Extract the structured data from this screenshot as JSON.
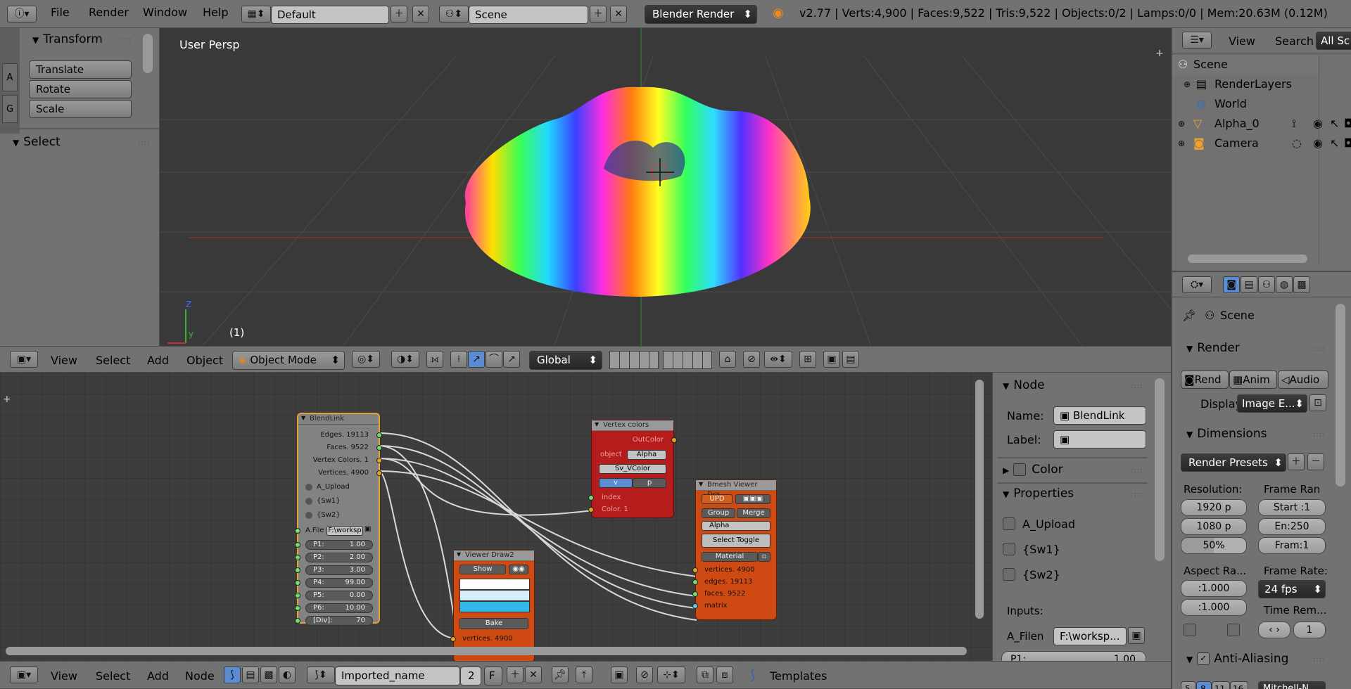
{
  "top_header": {
    "menus": [
      "File",
      "Render",
      "Window",
      "Help"
    ],
    "layout": "Default",
    "scene": "Scene",
    "engine": "Blender Render",
    "stats": "v2.77 | Verts:4,900 | Faces:9,522 | Tris:9,522 | Objects:0/2 | Lamps:0/0 | Mem:20.63M (0.12M)"
  },
  "tool_shelf": {
    "tabs": [
      "A",
      "G"
    ],
    "transform_title": "Transform",
    "buttons": [
      "Translate",
      "Rotate",
      "Scale"
    ],
    "select_title": "Select"
  },
  "viewport": {
    "label": "User Persp",
    "frame": "(1)",
    "axis_z": "Z",
    "axis_y": "y"
  },
  "view3d_header": {
    "menus": [
      "View",
      "Select",
      "Add",
      "Object"
    ],
    "mode": "Object Mode",
    "orientation": "Global"
  },
  "outliner": {
    "menus": [
      "View",
      "Search"
    ],
    "filter": "All Sc",
    "rows": [
      "Scene",
      "RenderLayers",
      "World",
      "Alpha_0",
      "Camera"
    ]
  },
  "properties": {
    "context": "Scene",
    "render_title": "Render",
    "render_buttons": [
      "Rend",
      "Anim",
      "Audio"
    ],
    "display_label": "Display",
    "display_value": "Image E...",
    "dimensions_title": "Dimensions",
    "render_presets": "Render Presets",
    "resolution_label": "Resolution:",
    "res_x": "1920 p",
    "res_y": "1080 p",
    "res_pct": "50%",
    "frame_range_label": "Frame Ran",
    "start": "Start :1",
    "end": "En:250",
    "frame": "Fram:1",
    "aspect_label": "Aspect Ra...",
    "aspect_x": ":1.000",
    "aspect_y": ":1.000",
    "frame_rate_label": "Frame Rate:",
    "fps": "24 fps",
    "time_remap_label": "Time Rem...",
    "time_remap_value": "1",
    "aa_title": "Anti-Aliasing",
    "aa_values": [
      "5",
      "8",
      "11",
      "16"
    ],
    "aa_filter": "Mitchell-N"
  },
  "node_sidebar": {
    "node_title": "Node",
    "name_label": "Name:",
    "name_value": "BlendLink",
    "label_label": "Label:",
    "color_title": "Color",
    "properties_title": "Properties",
    "checks": [
      "A_Upload",
      "{Sw1}",
      "{Sw2}"
    ],
    "inputs_label": "Inputs:",
    "afilen_label": "A_Filen",
    "afilen_value": "F:\\worksp...",
    "p1_label": "P1:",
    "p1_value": "1.00"
  },
  "nodes": {
    "blendlink": {
      "title": "BlendLink",
      "outputs": [
        "Edges. 19113",
        "Faces. 9522",
        "Vertex Colors. 1",
        "Vertices. 4900"
      ],
      "checks": [
        "A_Upload",
        "{Sw1}",
        "{Sw2}"
      ],
      "afile_label": "A.File",
      "afile_value": "F:\\worksp",
      "params": [
        [
          "P1:",
          "1.00"
        ],
        [
          "P2:",
          "2.00"
        ],
        [
          "P3:",
          "3.00"
        ],
        [
          "P4:",
          "99.00"
        ],
        [
          "P5:",
          "0.00"
        ],
        [
          "P6:",
          "10.00"
        ],
        [
          "[Div]:",
          "70"
        ]
      ]
    },
    "vertex_colors": {
      "title": "Vertex colors",
      "out": "OutColor",
      "object_label": "object",
      "object_value": "Alpha",
      "vcol": "Sv_VColor",
      "btn_v": "v",
      "btn_p": "p",
      "in1": "index",
      "in2": "Color. 1"
    },
    "bmesh_viewer": {
      "title": "Bmesh Viewer Dra...",
      "upd": "UPD",
      "group": "Group",
      "merge": "Merge",
      "alpha": "Alpha",
      "select_toggle": "Select Toggle",
      "material": "Material",
      "inputs": [
        "vertices. 4900",
        "edges. 19113",
        "faces. 9522",
        "matrix"
      ]
    },
    "viewer_draw": {
      "title": "Viewer Draw2",
      "show": "Show",
      "bake": "Bake",
      "input": "vertices. 4900"
    }
  },
  "node_header": {
    "menus": [
      "View",
      "Select",
      "Add",
      "Node"
    ],
    "tree_name": "Imported_name",
    "users": "2",
    "fake": "F",
    "templates": "Templates"
  }
}
